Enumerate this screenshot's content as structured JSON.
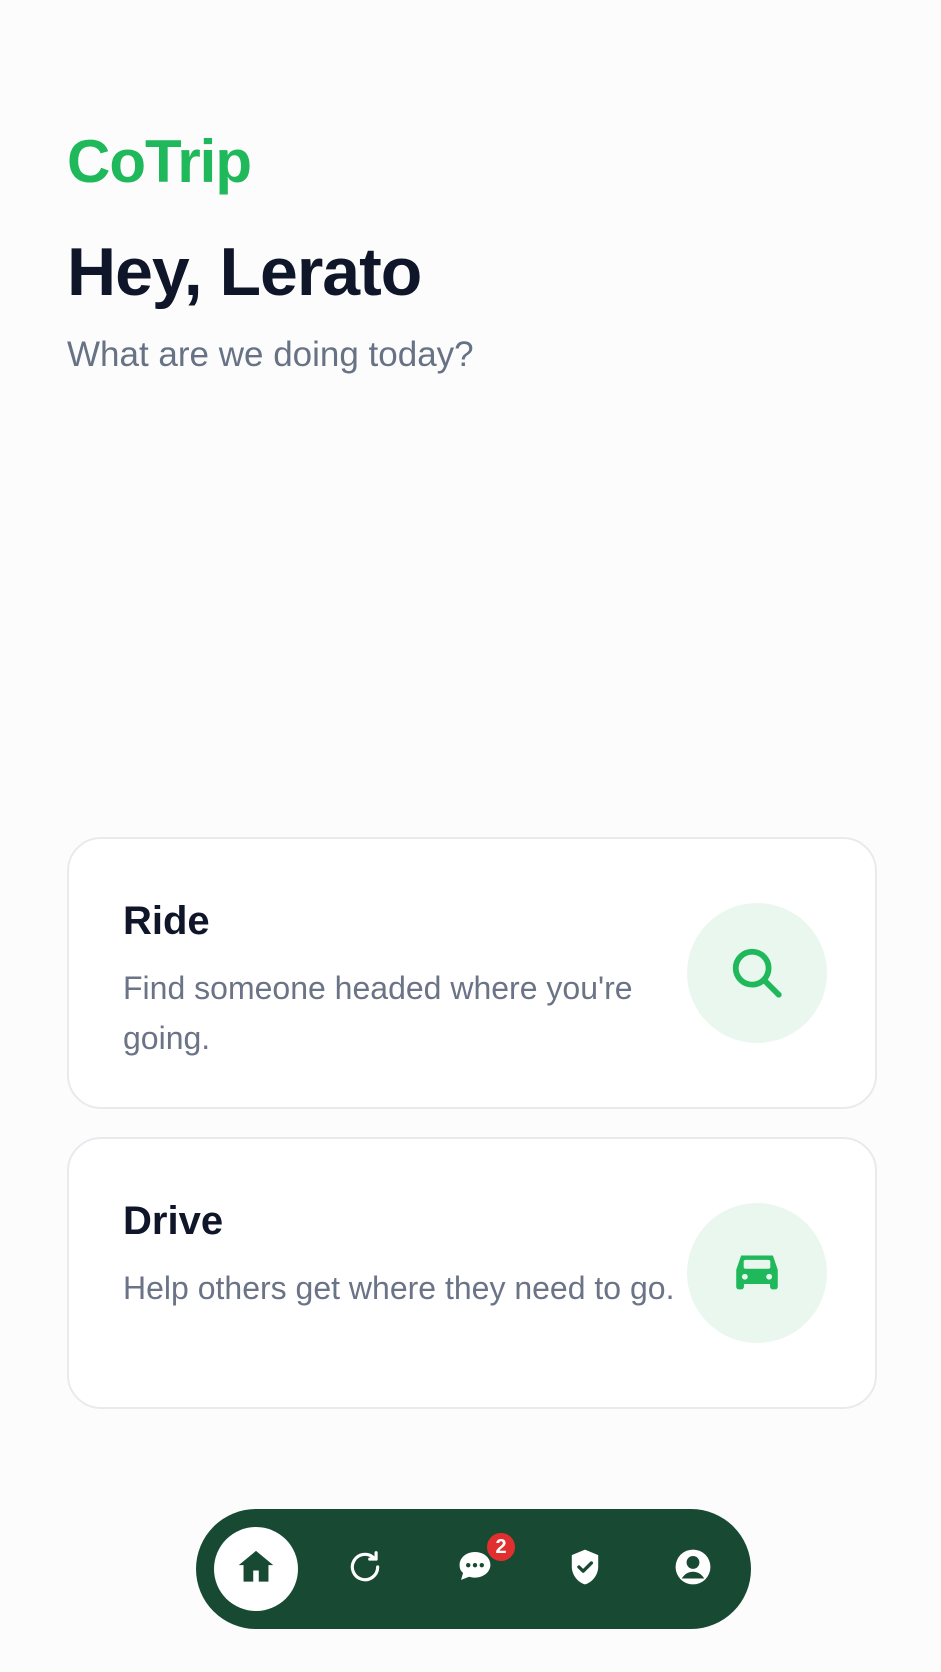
{
  "brand": {
    "name": "CoTrip",
    "color": "#1fb85a"
  },
  "header": {
    "greeting": "Hey, Lerato",
    "subtitle": "What are we doing today?"
  },
  "cards": [
    {
      "title": "Ride",
      "description": "Find someone headed where you're going.",
      "icon": "search-icon"
    },
    {
      "title": "Drive",
      "description": "Help others get where they need to go.",
      "icon": "car-icon"
    }
  ],
  "bottom_nav": {
    "items": [
      {
        "icon": "home-icon",
        "active": true
      },
      {
        "icon": "refresh-icon",
        "active": false
      },
      {
        "icon": "chat-icon",
        "active": false,
        "badge": "2"
      },
      {
        "icon": "shield-check-icon",
        "active": false
      },
      {
        "icon": "profile-icon",
        "active": false
      }
    ],
    "background": "#184a33"
  }
}
